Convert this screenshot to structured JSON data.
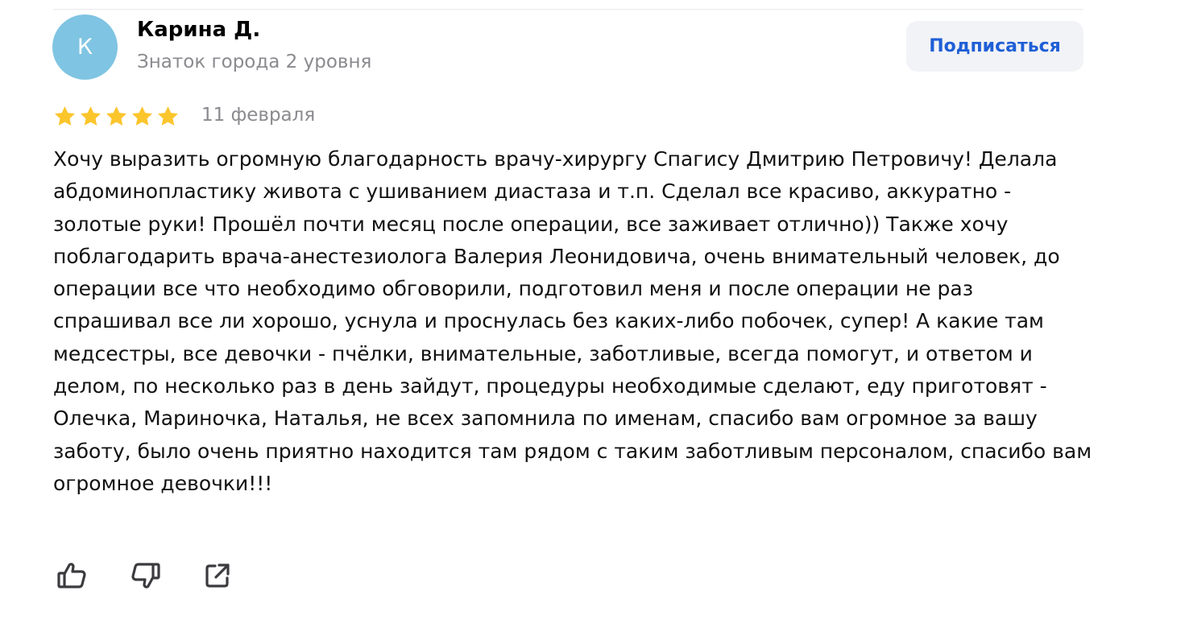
{
  "colors": {
    "avatar_bg": "#7fc4e3",
    "star": "#fbc52c",
    "subscribe_text": "#1f5fd6",
    "subscribe_bg": "#f2f3f7",
    "muted_text": "#8a8a8f"
  },
  "author": {
    "avatar_letter": "К",
    "name": "Карина Д.",
    "level": "Знаток города 2 уровня"
  },
  "subscribe_label": "Подписаться",
  "review": {
    "rating": 5,
    "rating_max": 5,
    "date": "11 февраля",
    "text": "Хочу выразить огромную благодарность врачу-хирургу Спагису Дмитрию Петровичу! Делала абдоминопластику живота с ушиванием диастаза и т.п. Сделал все красиво, аккуратно - золотые руки! Прошёл почти месяц после операции, все заживает отлично)) Также хочу поблагодарить врача-анестезиолога Валерия Леонидовича, очень внимательный человек, до операции все что необходимо обговорили, подготовил меня и после операции не раз спрашивал все ли хорошо, уснула и проснулась без каких-либо побочек, супер! А какие там медсестры, все девочки - пчёлки, внимательные, заботливые, всегда помогут, и ответом и делом, по несколько раз в день зайдут, процедуры необходимые сделают, еду приготовят - Олечка, Мариночка, Наталья, не всех запомнила по именам, спасибо вам огромное за вашу заботу, было очень приятно находится там рядом с таким заботливым персоналом, спасибо вам огромное девочки!!!"
  },
  "actions": {
    "like_icon": "thumbs-up-icon",
    "dislike_icon": "thumbs-down-icon",
    "share_icon": "share-icon"
  }
}
